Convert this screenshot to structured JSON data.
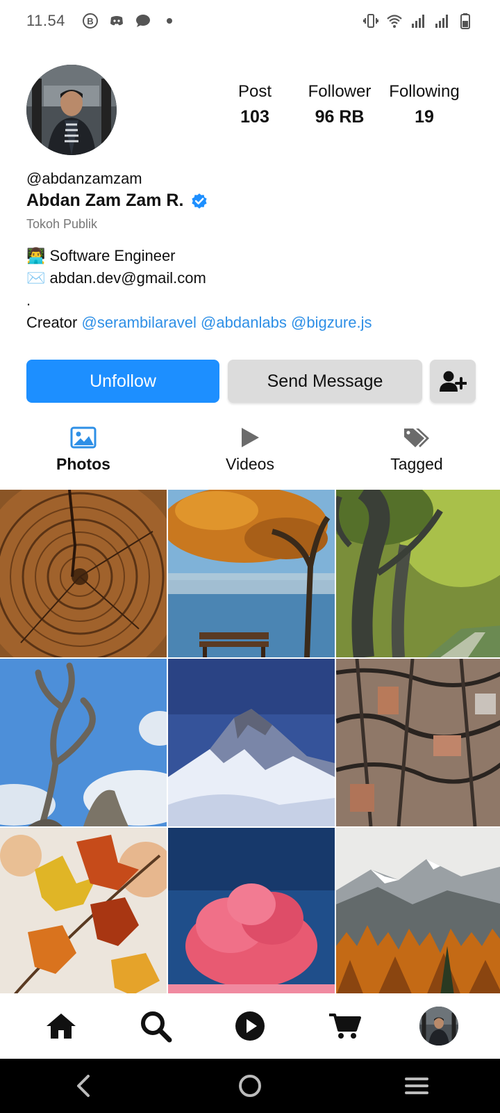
{
  "status_bar": {
    "time": "11.54",
    "left_icons": [
      "bitcoin-icon",
      "discord-icon",
      "chat-icon",
      "dot-icon"
    ],
    "right_icons": [
      "vibrate-icon",
      "wifi-icon",
      "signal-icon",
      "signal-icon",
      "battery-icon"
    ]
  },
  "profile": {
    "username": "@abdanzamzam",
    "full_name": "Abdan Zam Zam R.",
    "category": "Tokoh Publik",
    "verified": true,
    "stats": [
      {
        "label": "Post",
        "value": "103"
      },
      {
        "label": "Follower",
        "value": "96 RB"
      },
      {
        "label": "Following",
        "value": "19"
      }
    ],
    "bio": {
      "line1": "👨‍💻 Software Engineer",
      "line2": "✉️ abdan.dev@gmail.com",
      "line3": ".",
      "creator_prefix": "Creator ",
      "creator_links": [
        "@serambilaravel",
        "@abdanlabs",
        "@bigzure.js"
      ]
    }
  },
  "actions": {
    "unfollow_label": "Unfollow",
    "message_label": "Send Message",
    "add_user_icon": "add-user-icon"
  },
  "tabs": [
    {
      "label": "Photos",
      "icon": "image-icon",
      "active": true
    },
    {
      "label": "Videos",
      "icon": "play-icon",
      "active": false
    },
    {
      "label": "Tagged",
      "icon": "tags-icon",
      "active": false
    }
  ],
  "photos": [
    {
      "subject": "tree-rings"
    },
    {
      "subject": "autumn-tree-lake"
    },
    {
      "subject": "tree-avenue"
    },
    {
      "subject": "dead-tree-sky"
    },
    {
      "subject": "snowy-mountain"
    },
    {
      "subject": "tree-bark"
    },
    {
      "subject": "autumn-leaves"
    },
    {
      "subject": "pink-tree"
    },
    {
      "subject": "mountain-autumn-forest"
    }
  ],
  "bottom_nav": [
    "home-icon",
    "search-icon",
    "play-circle-icon",
    "cart-icon",
    "profile-avatar"
  ],
  "colors": {
    "accent": "#1d8fff",
    "link": "#2e8fe6",
    "verified": "#1d8fff",
    "secondary_button": "#dcdcdc"
  }
}
